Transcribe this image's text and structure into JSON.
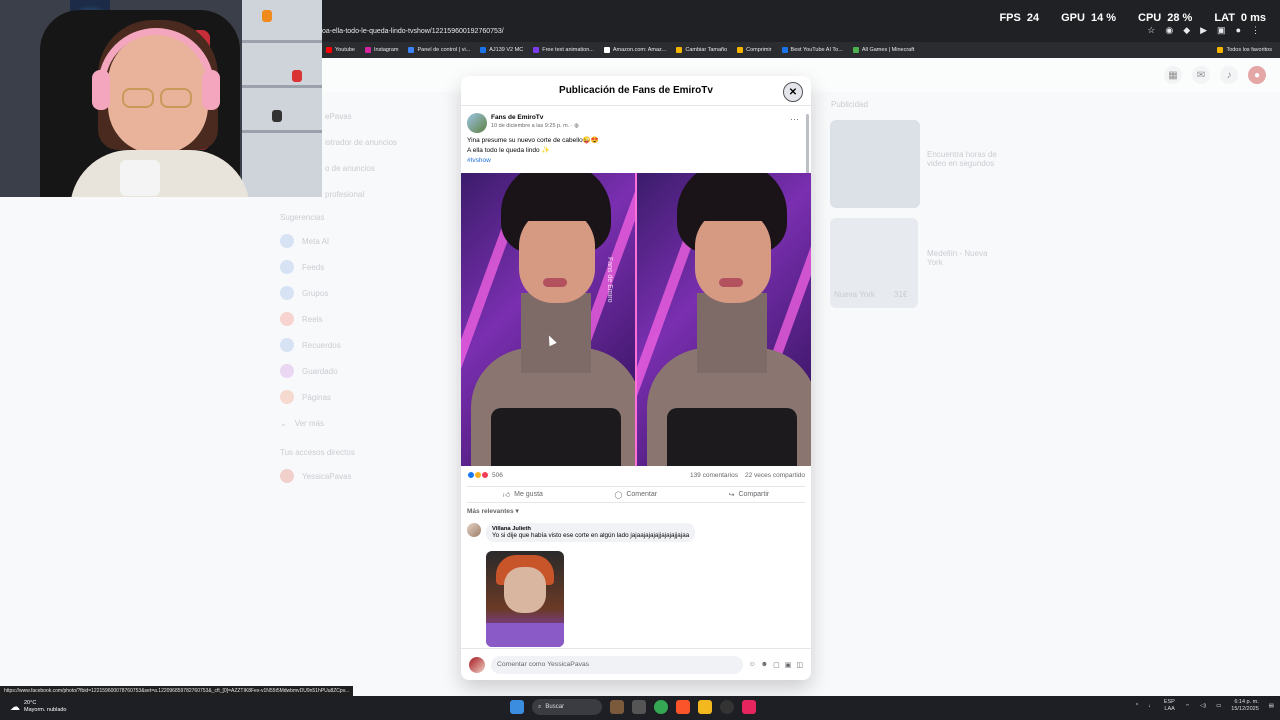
{
  "browser": {
    "url": "oa-ella-todo-le-queda-lindo-tvshow/122159600192760753/",
    "hud": [
      {
        "label": "FPS",
        "value": "24"
      },
      {
        "label": "GPU",
        "value": "14 %"
      },
      {
        "label": "CPU",
        "value": "28 %"
      },
      {
        "label": "LAT",
        "value": "0 ms"
      }
    ],
    "bookmarks": [
      "Youtube",
      "Instagram",
      "Panel de control | vi...",
      "AJ139 V2 MC",
      "Free text animation...",
      "Amazon.com: Amaz...",
      "Cambiar Tamaño",
      "Comprimir",
      "Best YouTube AI To...",
      "All Games | Minecraft"
    ],
    "bookmarks_right": "Todos los favoritos"
  },
  "background": {
    "left_menu_partial": [
      "ePavas",
      "istrador de anuncios",
      "o de anuncios",
      "profesional"
    ],
    "suggestions_heading": "Sugerencias",
    "menu": [
      "Meta AI",
      "Feeds",
      "Grupos",
      "Reels",
      "Recuerdos",
      "Guardado",
      "Páginas",
      "Ver más"
    ],
    "shortcuts_heading": "Tus accesos directos",
    "shortcut": "YessicaPavas",
    "ads_heading": "Publicidad",
    "ad1_text": "Encuentra horas de video en segundos",
    "ad2_text": "Medellín - Nueva York",
    "ad2_caption": "Nueva York",
    "ad2_price": "31€"
  },
  "modal": {
    "title": "Publicación de Fans de EmiroTv",
    "close_icon": "close-icon",
    "page_name": "Fans de EmiroTv",
    "date": "10 de diciembre a las 9:25 p. m. ·",
    "text_line1": "Yina presume su nuevo corte de cabello😜😍",
    "text_line2": "A ella todo le queda lindo ✨",
    "hashtag": "#tvshow",
    "watermark": "Fans de Emiro",
    "reactions_count": "506",
    "comments_count": "139 comentarios",
    "shares_count": "22 veces compartido",
    "like_label": "Me gusta",
    "comment_label": "Comentar",
    "share_label": "Compartir",
    "sort_label": "Más relevantes",
    "comment": {
      "author": "Villana Julieth",
      "text": "Yo si dije que había visto ese corte en algún lado jajaajajajajjajajajjajaa"
    },
    "composer_placeholder": "Comentar como YessicaPavas"
  },
  "status_url": "https://www.facebook.com/photo/?fbid=122159600078760753&set=a.122096859782760753&_cft_[0]=AZZTIK8Fex-v1N55t5MdwbmvDU9n51hPUu8ZCpv...",
  "taskbar": {
    "weather_temp": "20°C",
    "weather_desc": "Mayorm. nublado",
    "search_label": "Buscar",
    "lang": "ESP",
    "lang2": "LAA",
    "time": "6:14 p. m.",
    "date": "15/12/2025"
  }
}
